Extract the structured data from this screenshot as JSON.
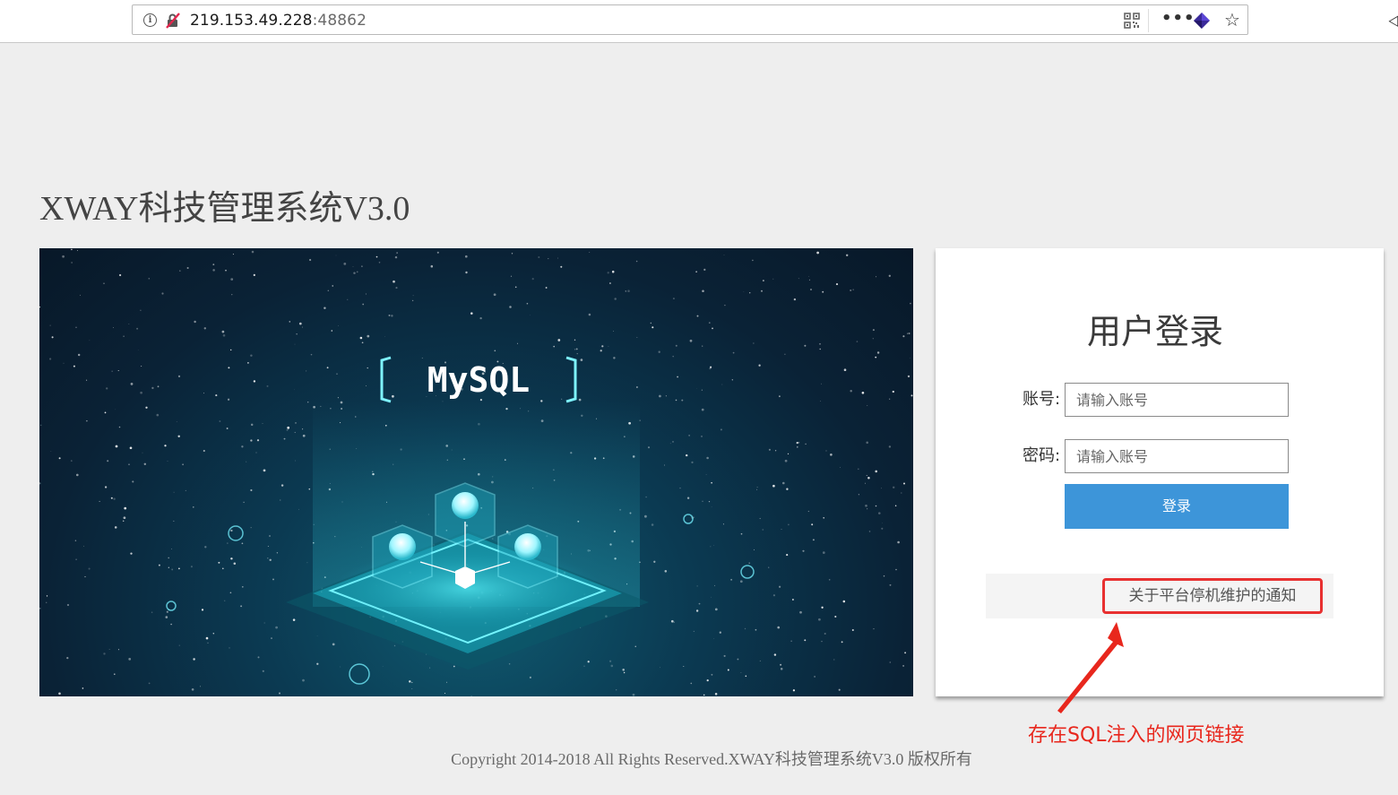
{
  "browser": {
    "url_host": "219.153.49.228",
    "url_port": ":48862",
    "icons": [
      "info-icon",
      "insecure-connection-icon",
      "qr-code-icon",
      "more-actions-icon",
      "extension-icon",
      "bookmark-star-icon"
    ],
    "more_glyph": "•••",
    "star_glyph": "☆",
    "info_glyph": "i",
    "edge_glyph": "⨞"
  },
  "page": {
    "title": "XWAY科技管理系统V3.0",
    "banner_text": "MySQL"
  },
  "login": {
    "title": "用户登录",
    "account_label": "账号:",
    "account_placeholder": "请输入账号",
    "password_label": "密码:",
    "password_placeholder": "请输入账号",
    "submit_label": "登录",
    "submit_color": "#3d95d9"
  },
  "notice": {
    "link_text": "关于平台停机维护的通知",
    "highlight_color": "#e83030"
  },
  "annotation": {
    "text": "存在SQL注入的网页链接",
    "color": "#e8271d"
  },
  "footer": {
    "copyright": "Copyright 2014-2018 All Rights Reserved.XWAY科技管理系统V3.0 版权所有"
  }
}
